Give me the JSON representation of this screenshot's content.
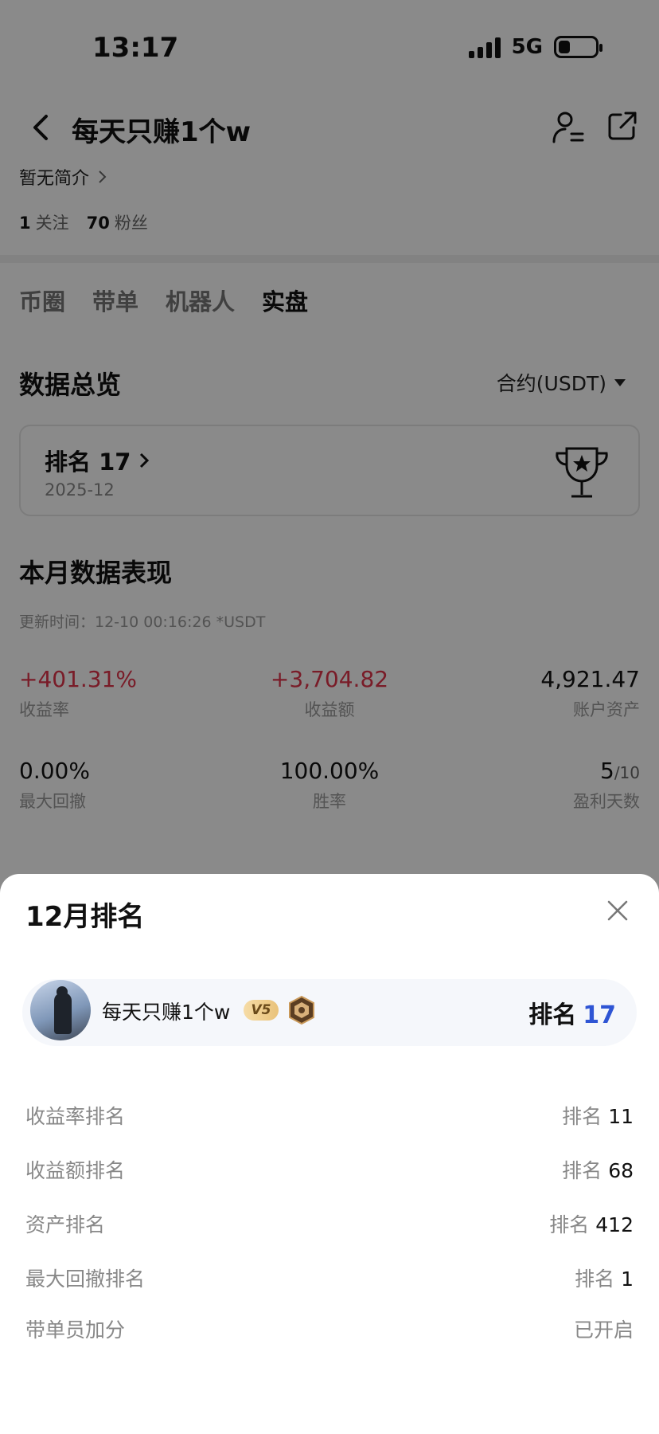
{
  "status_bar": {
    "time": "13:17",
    "network": "5G"
  },
  "header": {
    "title": "每天只赚1个w"
  },
  "profile": {
    "bio": "暂无简介",
    "following_count": "1",
    "following_label": "关注",
    "followers_count": "70",
    "followers_label": "粉丝"
  },
  "tabs": [
    {
      "label": "币圈",
      "active": false
    },
    {
      "label": "带单",
      "active": false
    },
    {
      "label": "机器人",
      "active": false
    },
    {
      "label": "实盘",
      "active": true
    }
  ],
  "overview": {
    "title": "数据总览",
    "contract_select": "合约(USDT)"
  },
  "rank_card": {
    "title": "排名 17",
    "date": "2025-12"
  },
  "month": {
    "title": "本月数据表现",
    "update": "更新时间：12-10 00:16:26  *USDT",
    "metrics": [
      {
        "value": "+401.31%",
        "label": "收益率"
      },
      {
        "value": "+3,704.82",
        "label": "收益额"
      },
      {
        "value": "4,921.47",
        "label": "账户资产"
      },
      {
        "value": "0.00%",
        "label": "最大回撤"
      },
      {
        "value": "100.00%",
        "label": "胜率"
      },
      {
        "value": "5",
        "value_suffix": "/10",
        "label": "盈利天数"
      }
    ]
  },
  "sheet": {
    "title": "12月排名",
    "user": {
      "name": "每天只赚1个w",
      "level": "V5",
      "rank_label": "排名",
      "rank_value": "17"
    },
    "rows": [
      {
        "label": "收益率排名",
        "prefix": "排名",
        "value": "11"
      },
      {
        "label": "收益额排名",
        "prefix": "排名",
        "value": "68"
      },
      {
        "label": "资产排名",
        "prefix": "排名",
        "value": "412"
      },
      {
        "label": "最大回撤排名",
        "prefix": "排名",
        "value": "1"
      },
      {
        "label": "带单员加分",
        "prefix": "",
        "value": "已开启"
      }
    ]
  },
  "colors": {
    "profit_red": "#e0344a",
    "rank_blue": "#2f55d4",
    "overlay": "rgba(0,0,0,0.46)"
  }
}
